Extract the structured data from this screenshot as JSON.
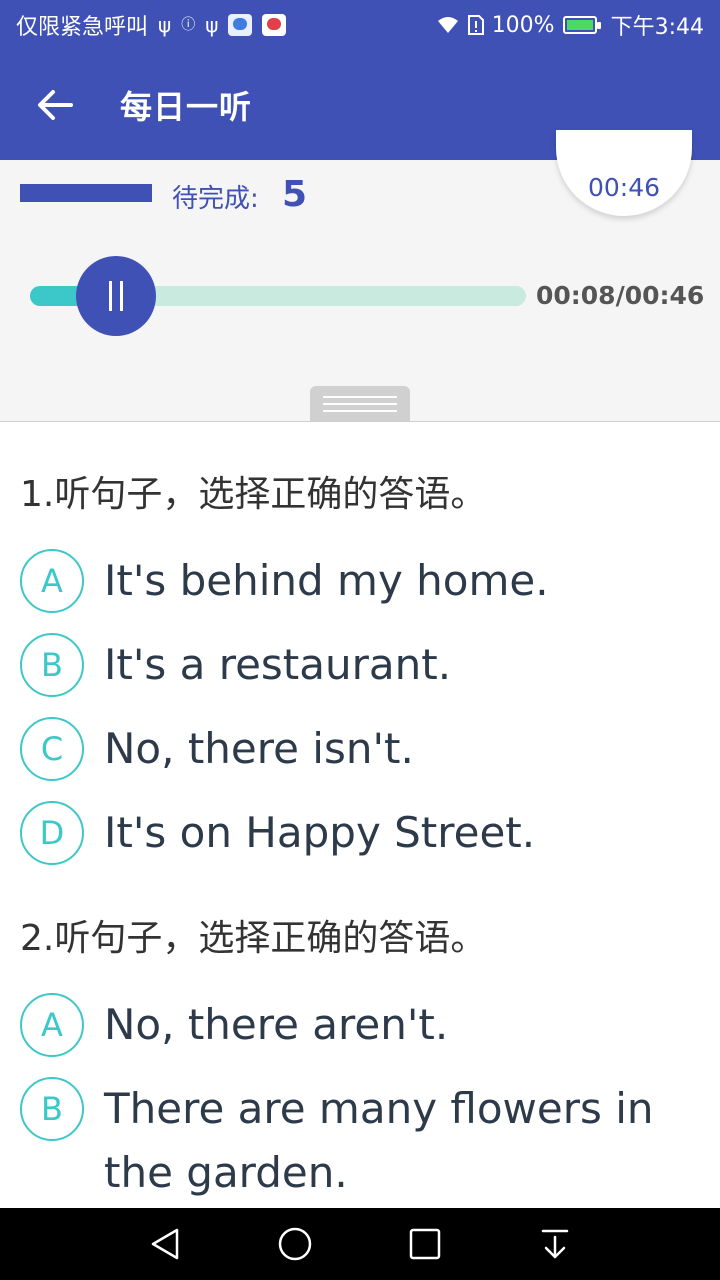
{
  "status_bar": {
    "carrier_text": "仅限紧急呼叫",
    "battery_percent": "100%",
    "time": "下午3:44"
  },
  "app_bar": {
    "title": "每日一听"
  },
  "player": {
    "pending_label": "待完成:",
    "pending_count": "5",
    "countdown": "00:46",
    "elapsed_total": "00:08/00:46",
    "progress_fraction": 0.174
  },
  "questions": [
    {
      "title": "1.听句子，选择正确的答语。",
      "options": [
        {
          "letter": "A",
          "text": "It's behind my home."
        },
        {
          "letter": "B",
          "text": "It's a restaurant."
        },
        {
          "letter": "C",
          "text": "No, there isn't."
        },
        {
          "letter": "D",
          "text": "It's on Happy Street."
        }
      ]
    },
    {
      "title": "2.听句子，选择正确的答语。",
      "options": [
        {
          "letter": "A",
          "text": "No, there aren't."
        },
        {
          "letter": "B",
          "text": "There are many flowers in the garden."
        }
      ]
    }
  ],
  "colors": {
    "primary": "#3f51b5",
    "accent": "#3cc8c8",
    "track": "#c8eadf"
  }
}
